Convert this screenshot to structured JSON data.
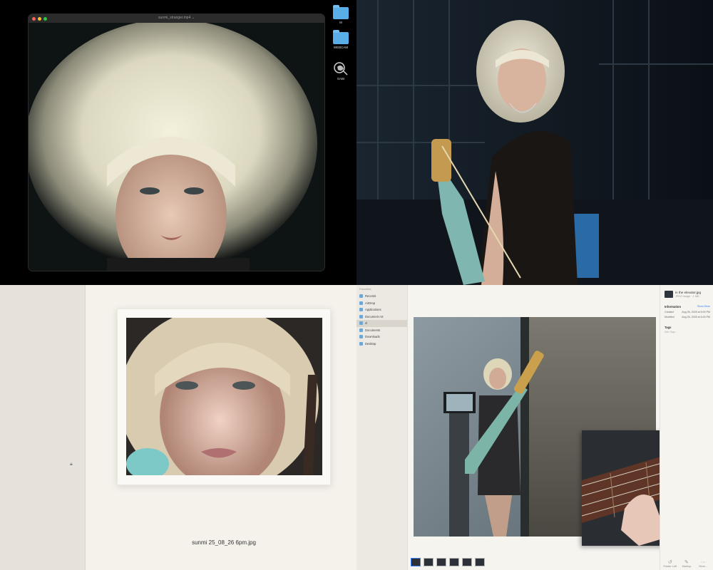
{
  "preview_window": {
    "title": "sunmi_stranger.mp4 ⌄",
    "desktop_icons": [
      {
        "label": "M",
        "icon": "folder-icon"
      },
      {
        "label": "WEBCAM",
        "icon": "folder-icon"
      },
      {
        "label": "SABI",
        "icon": "app-icon"
      }
    ]
  },
  "print_preview": {
    "caption": "sunmi 25_08_26 6pm.jpg"
  },
  "finder": {
    "sidebar_heading": "Favorites",
    "sidebar_items": [
      {
        "label": "Recents",
        "icon": "clock-icon"
      },
      {
        "label": "AirDrop",
        "icon": "airdrop-icon"
      },
      {
        "label": "Applications",
        "icon": "applications-icon"
      },
      {
        "label": "Document AS",
        "icon": "folder-icon"
      },
      {
        "label": "sl",
        "icon": "folder-icon"
      },
      {
        "label": "Documents",
        "icon": "document-icon"
      },
      {
        "label": "Downloads",
        "icon": "download-icon"
      },
      {
        "label": "Desktop",
        "icon": "desktop-icon"
      }
    ],
    "active_sidebar_index": 4,
    "info": {
      "filename": "in the elevator.jpg",
      "subtitle": "JPEG image · 1 MB",
      "section_information": "Information",
      "show_more": "Show More",
      "rows": [
        {
          "key": "Created",
          "value": "Aug 26, 2025 at 6:00 PM"
        },
        {
          "key": "Modified",
          "value": "Aug 26, 2025 at 6:00 PM"
        }
      ],
      "section_tags": "Tags",
      "tags_placeholder": "Add Tags...",
      "actions": [
        {
          "label": "Rotate Left",
          "icon": "rotate-left-icon"
        },
        {
          "label": "Markup",
          "icon": "markup-icon"
        },
        {
          "label": "More...",
          "icon": "more-icon"
        }
      ]
    },
    "thumbnail_count": 6,
    "selected_thumbnail": 0
  }
}
